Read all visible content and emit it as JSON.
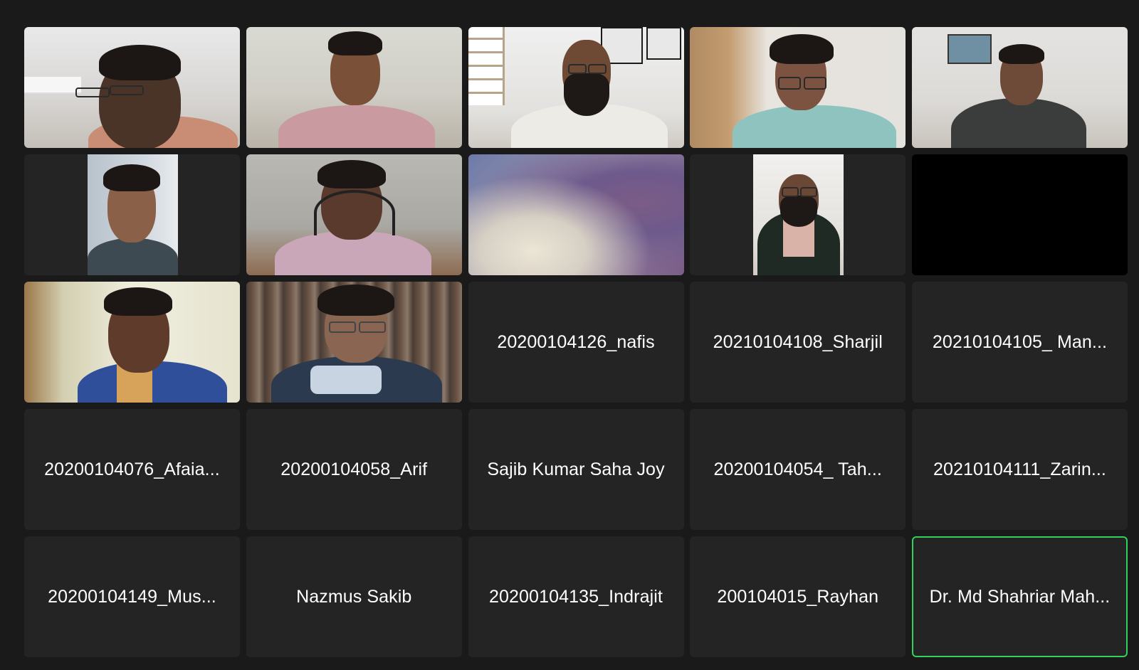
{
  "colors": {
    "window_bg": "#1a1a1a",
    "tile_bg": "#242424",
    "active_speaker_border": "#2fd25a",
    "name_text": "#ffffff"
  },
  "gallery": {
    "video_tiles": [
      {
        "feed": "man-glasses-hand-on-chin"
      },
      {
        "feed": "man-smiling-pink-shirt"
      },
      {
        "feed": "bald-bearded-man-glasses"
      },
      {
        "feed": "man-glasses-teal-shirt"
      },
      {
        "feed": "young-man-dark-shirt"
      },
      {
        "feed": "young-man-portrait"
      },
      {
        "feed": "young-man-headphones"
      },
      {
        "feed": "blurred-background"
      },
      {
        "feed": "bearded-man-vest-portrait"
      },
      {
        "feed": "blank-black"
      },
      {
        "feed": "young-man-blue-jacket"
      },
      {
        "feed": "young-man-glasses-earphones"
      }
    ],
    "name_tiles": [
      {
        "name": "20200104126_nafis"
      },
      {
        "name": "20210104108_Sharjil"
      },
      {
        "name": "20210104105_ Man..."
      },
      {
        "name": "20200104076_Afaia..."
      },
      {
        "name": "20200104058_Arif"
      },
      {
        "name": "Sajib Kumar Saha Joy"
      },
      {
        "name": "20200104054_ Tah..."
      },
      {
        "name": "20210104111_Zarin..."
      },
      {
        "name": "20200104149_Mus..."
      },
      {
        "name": "Nazmus Sakib"
      },
      {
        "name": "20200104135_Indrajit"
      },
      {
        "name": "200104015_Rayhan"
      },
      {
        "name": "Dr. Md Shahriar Mah...",
        "active_speaker": true
      }
    ]
  }
}
